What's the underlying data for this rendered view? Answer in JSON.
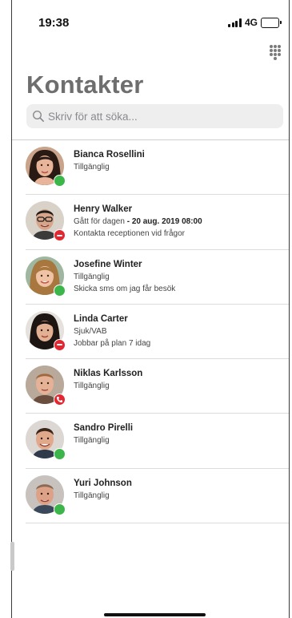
{
  "status_bar": {
    "time": "19:38",
    "network": "4G"
  },
  "title": "Kontakter",
  "search": {
    "placeholder": "Skriv för att söka..."
  },
  "colors": {
    "available": "#3cb54a",
    "busy": "#e3262f"
  },
  "contacts": [
    {
      "name": "Bianca Rosellini",
      "status": "Tillgänglig",
      "status_detail": "",
      "note": "",
      "presence": "available",
      "avatar": "woman-dark-hair"
    },
    {
      "name": "Henry Walker",
      "status": "Gått för dagen",
      "status_detail": "- 20 aug. 2019 08:00",
      "note": "Kontakta receptionen vid frågor",
      "presence": "busy",
      "avatar": "man-glasses"
    },
    {
      "name": "Josefine Winter",
      "status": "Tillgänglig",
      "status_detail": "",
      "note": "Skicka sms om jag får besök",
      "presence": "available",
      "avatar": "woman-blonde"
    },
    {
      "name": "Linda Carter",
      "status": "Sjuk/VAB",
      "status_detail": "",
      "note": "Jobbar på plan 7 idag",
      "presence": "busy",
      "avatar": "woman-dark-hair-2"
    },
    {
      "name": "Niklas Karlsson",
      "status": "Tillgänglig",
      "status_detail": "",
      "note": "",
      "presence": "on-call",
      "avatar": "man-short-hair"
    },
    {
      "name": "Sandro Pirelli",
      "status": "Tillgänglig",
      "status_detail": "",
      "note": "",
      "presence": "available",
      "avatar": "man-dark-hair"
    },
    {
      "name": "Yuri Johnson",
      "status": "Tillgänglig",
      "status_detail": "",
      "note": "",
      "presence": "available",
      "avatar": "man-older"
    }
  ]
}
